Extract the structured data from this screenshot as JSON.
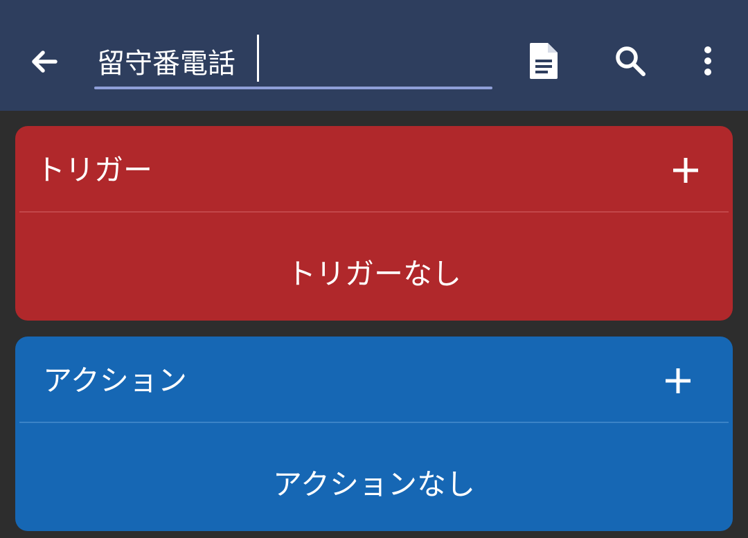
{
  "app_bar": {
    "macro_name": "留守番電話",
    "background": "#2e3e5e",
    "underline_color": "#8f9fd8",
    "icons": {
      "back": "arrow-back-icon",
      "document": "document-icon",
      "search": "search-icon",
      "more": "more-vertical-icon"
    }
  },
  "triggers": {
    "title": "トリガー",
    "add_label": "+",
    "empty_text": "トリガーなし",
    "color": "#b0282b"
  },
  "actions": {
    "title": "アクション",
    "add_label": "+",
    "empty_text": "アクションなし",
    "color": "#1667b4"
  },
  "background": "#2d2d2d"
}
